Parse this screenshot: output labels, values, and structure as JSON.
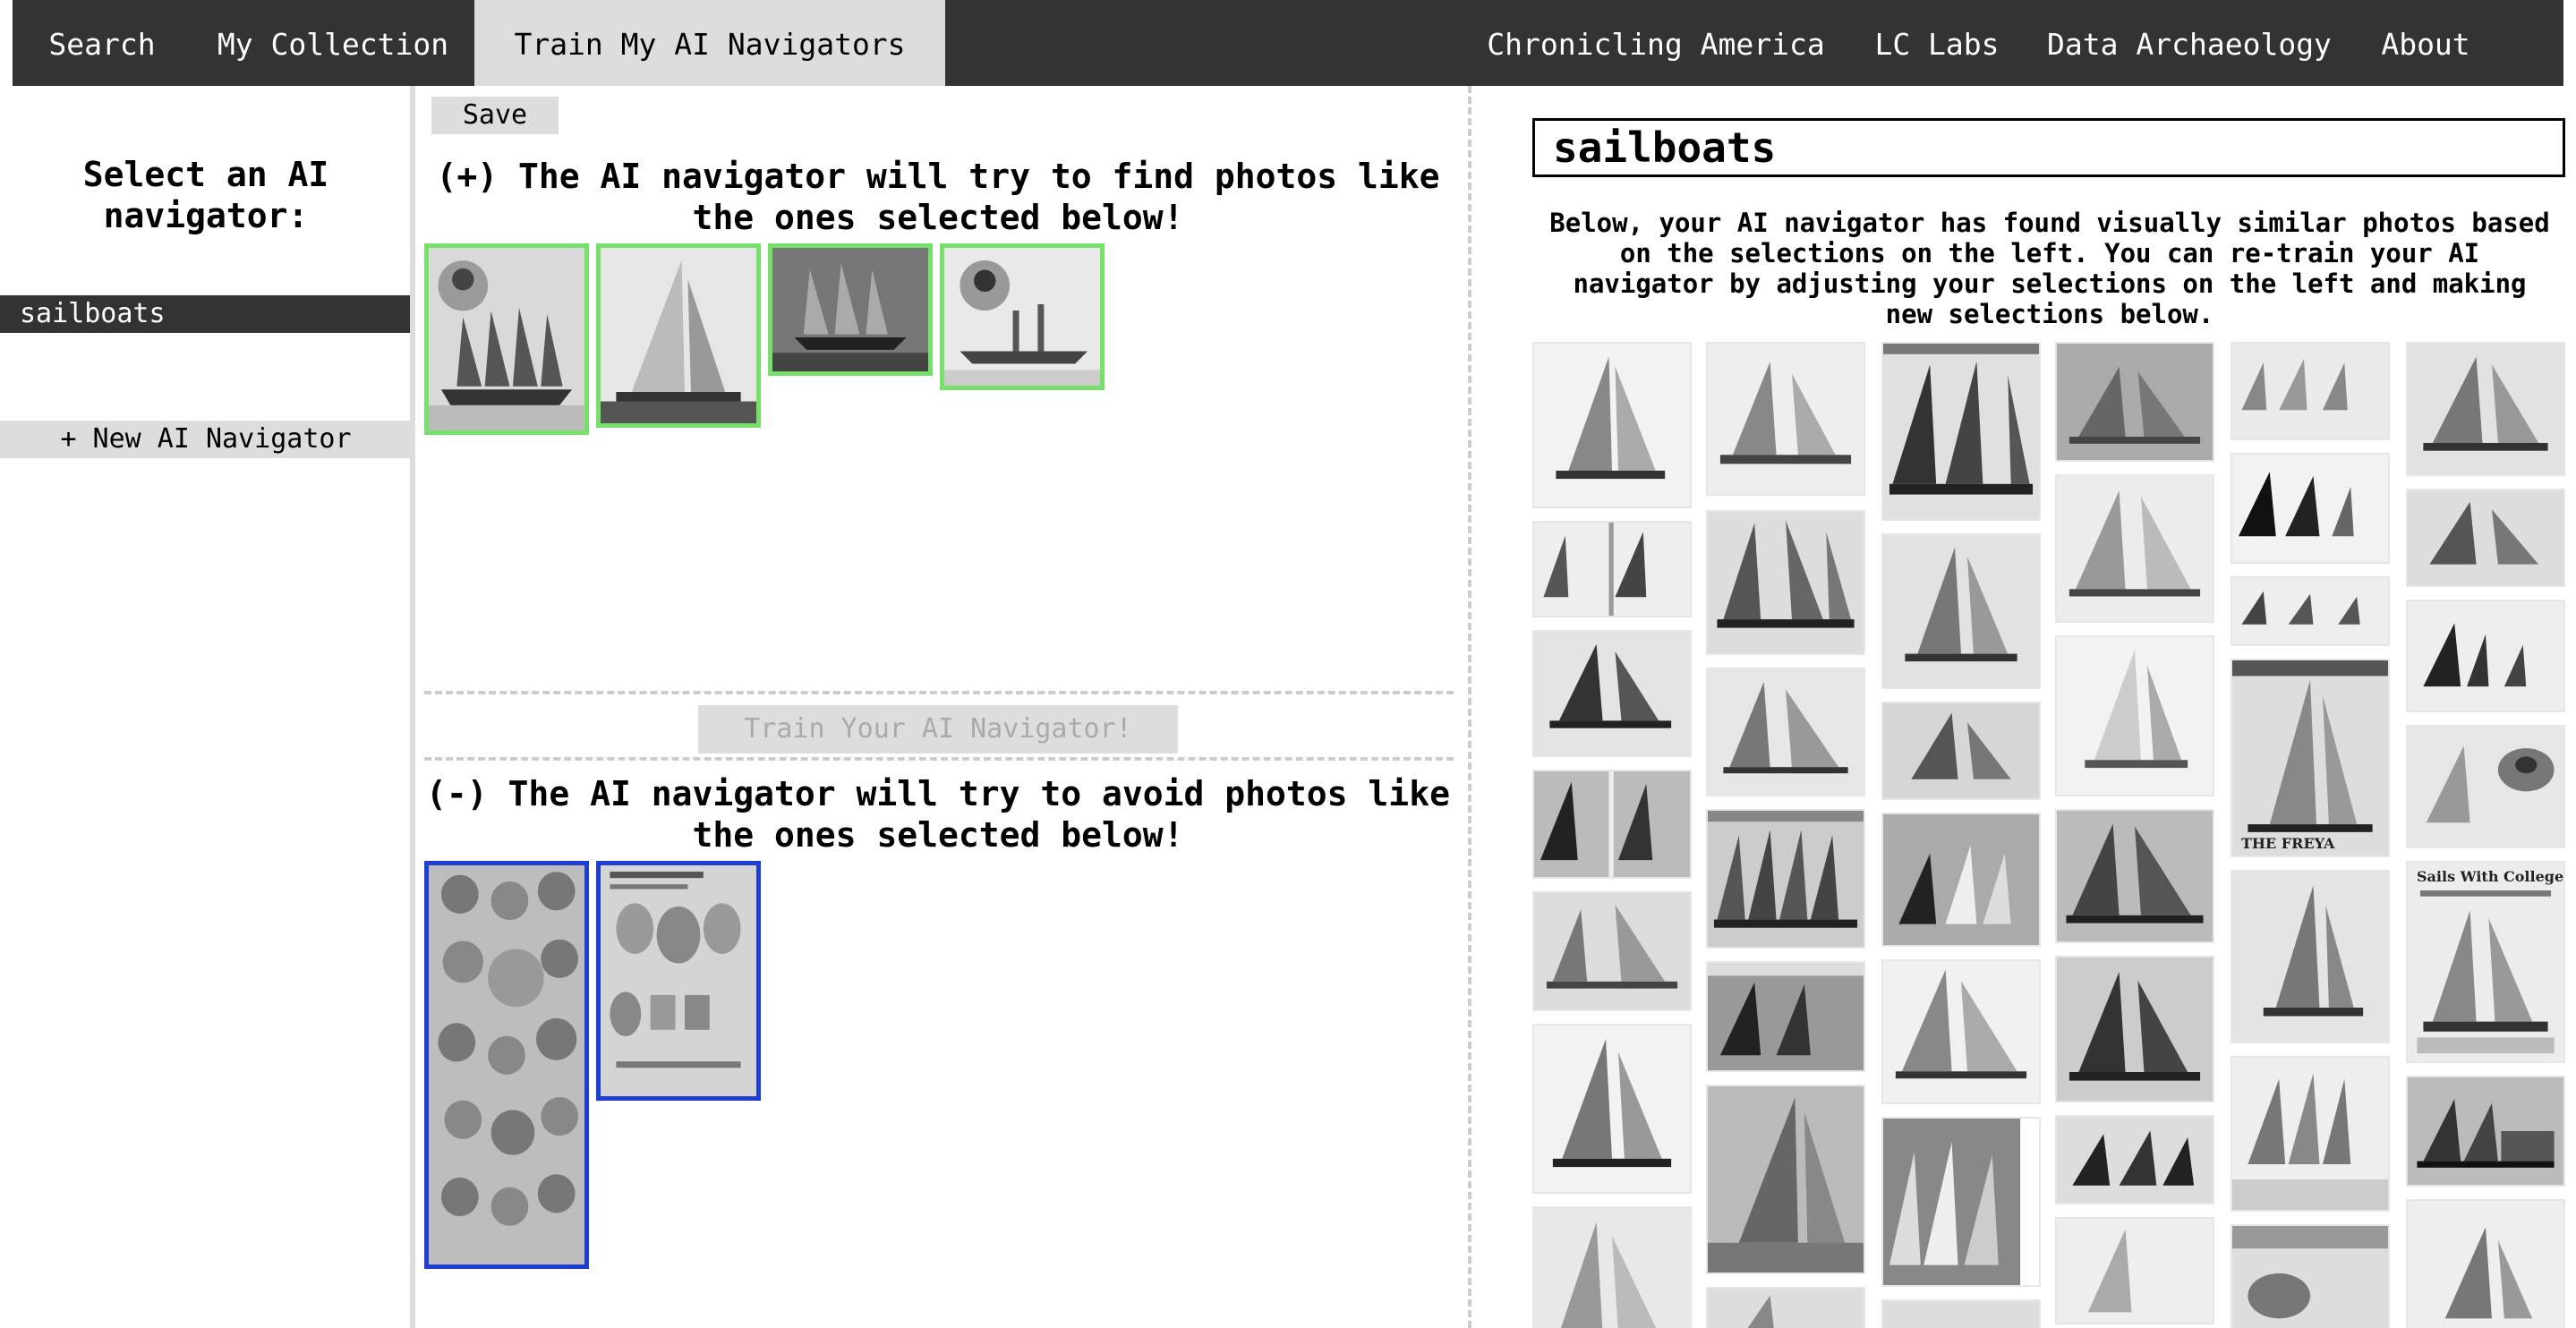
{
  "nav": {
    "items": [
      {
        "label": "Search",
        "active": false
      },
      {
        "label": "My Collection",
        "active": false
      },
      {
        "label": "Train My AI Navigators",
        "active": true
      },
      {
        "label": "Chronicling America",
        "active": false
      },
      {
        "label": "LC Labs",
        "active": false
      },
      {
        "label": "Data Archaeology",
        "active": false
      },
      {
        "label": "About",
        "active": false
      }
    ]
  },
  "sidebar": {
    "heading": "Select an AI navigator:",
    "navigators": [
      "sailboats"
    ],
    "new_button": "+ New AI Navigator"
  },
  "middle": {
    "save_label": "Save",
    "positive_heading": "(+) The AI navigator will try to find photos like the ones selected below!",
    "negative_heading": "(-) The AI navigator will try to avoid photos like the ones selected below!",
    "train_label": "Train Your AI Navigator!",
    "positive_count": 4,
    "negative_count": 2,
    "positive_mark": "plus-icon",
    "negative_mark": "minus-icon"
  },
  "results": {
    "title_value": "sailboats",
    "description": "Below, your AI navigator has found visually similar photos based on the selections on the left. You can re-train your AI navigator by adjusting your selections on the left and making new selections below.",
    "caption_visible_1": "Sails With College Men",
    "caption_visible_2": "THE FREYA"
  },
  "colors": {
    "nav_bg": "#333333",
    "nav_active_bg": "#dddddd",
    "positive_border": "#77e06a",
    "negative_border": "#1e3ed0",
    "button_bg": "#dddddd"
  }
}
